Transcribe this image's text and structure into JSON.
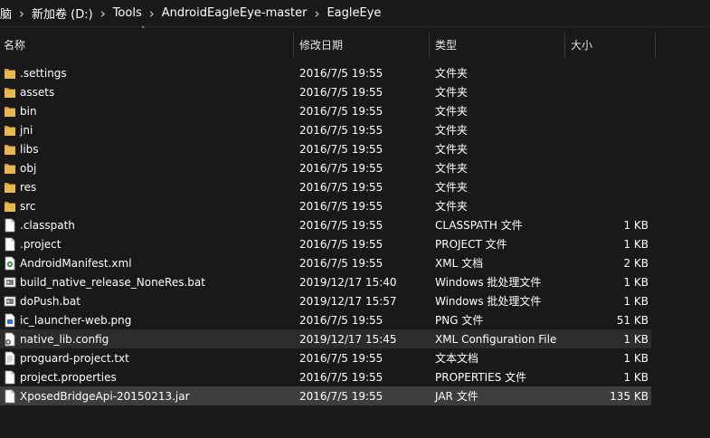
{
  "breadcrumb": {
    "items": [
      "脑",
      "新加卷 (D:)",
      "Tools",
      "AndroidEagleEye-master",
      "EagleEye"
    ]
  },
  "columns": {
    "name": "名称",
    "date": "修改日期",
    "type": "类型",
    "size": "大小"
  },
  "colors": {
    "folder": "#e8b84a",
    "background": "#191919",
    "selected": "#3d3d3d"
  },
  "files": [
    {
      "name": ".settings",
      "date": "2016/7/5 19:55",
      "type": "文件夹",
      "size": "",
      "icon": "folder-icon"
    },
    {
      "name": "assets",
      "date": "2016/7/5 19:55",
      "type": "文件夹",
      "size": "",
      "icon": "folder-icon"
    },
    {
      "name": "bin",
      "date": "2016/7/5 19:55",
      "type": "文件夹",
      "size": "",
      "icon": "folder-icon"
    },
    {
      "name": "jni",
      "date": "2016/7/5 19:55",
      "type": "文件夹",
      "size": "",
      "icon": "folder-icon"
    },
    {
      "name": "libs",
      "date": "2016/7/5 19:55",
      "type": "文件夹",
      "size": "",
      "icon": "folder-icon"
    },
    {
      "name": "obj",
      "date": "2016/7/5 19:55",
      "type": "文件夹",
      "size": "",
      "icon": "folder-icon"
    },
    {
      "name": "res",
      "date": "2016/7/5 19:55",
      "type": "文件夹",
      "size": "",
      "icon": "folder-icon"
    },
    {
      "name": "src",
      "date": "2016/7/5 19:55",
      "type": "文件夹",
      "size": "",
      "icon": "folder-icon"
    },
    {
      "name": ".classpath",
      "date": "2016/7/5 19:55",
      "type": "CLASSPATH 文件",
      "size": "1 KB",
      "icon": "file-icon"
    },
    {
      "name": ".project",
      "date": "2016/7/5 19:55",
      "type": "PROJECT 文件",
      "size": "1 KB",
      "icon": "file-icon"
    },
    {
      "name": "AndroidManifest.xml",
      "date": "2016/7/5 19:55",
      "type": "XML 文档",
      "size": "2 KB",
      "icon": "xml-icon"
    },
    {
      "name": "build_native_release_NoneRes.bat",
      "date": "2019/12/17 15:40",
      "type": "Windows 批处理文件",
      "size": "1 KB",
      "icon": "bat-icon"
    },
    {
      "name": "doPush.bat",
      "date": "2019/12/17 15:57",
      "type": "Windows 批处理文件",
      "size": "1 KB",
      "icon": "bat-icon"
    },
    {
      "name": "ic_launcher-web.png",
      "date": "2016/7/5 19:55",
      "type": "PNG 文件",
      "size": "51 KB",
      "icon": "image-icon"
    },
    {
      "name": "native_lib.config",
      "date": "2019/12/17 15:45",
      "type": "XML Configuration File",
      "size": "1 KB",
      "icon": "config-icon"
    },
    {
      "name": "proguard-project.txt",
      "date": "2016/7/5 19:55",
      "type": "文本文档",
      "size": "1 KB",
      "icon": "text-file-icon"
    },
    {
      "name": "project.properties",
      "date": "2016/7/5 19:55",
      "type": "PROPERTIES 文件",
      "size": "1 KB",
      "icon": "file-icon"
    },
    {
      "name": "XposedBridgeApi-20150213.jar",
      "date": "2016/7/5 19:55",
      "type": "JAR 文件",
      "size": "135 KB",
      "icon": "file-icon"
    }
  ]
}
